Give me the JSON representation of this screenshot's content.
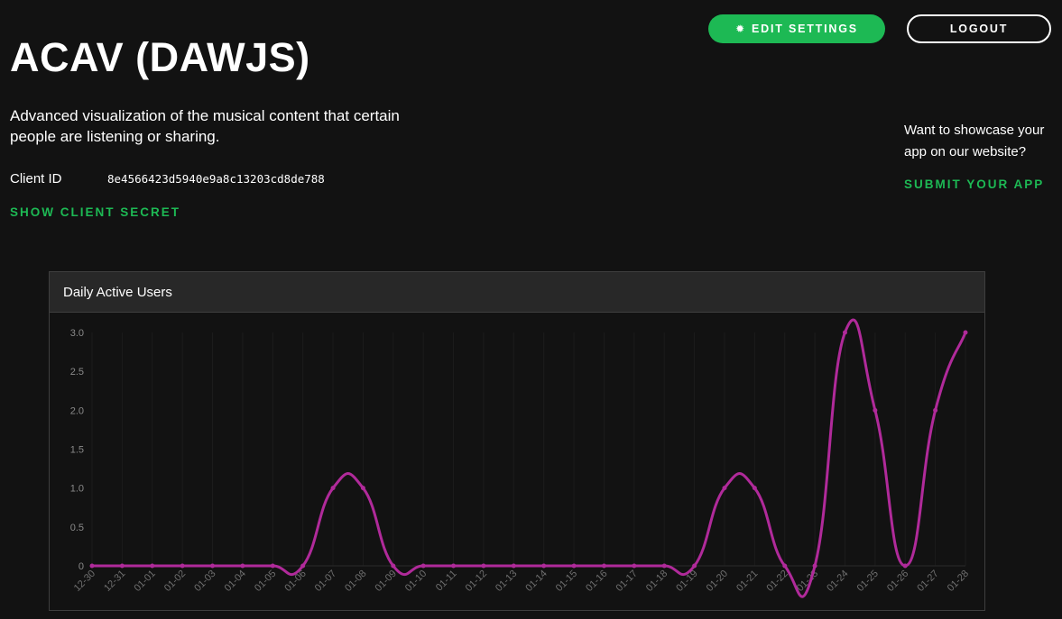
{
  "app": {
    "title": "ACAV (DAWJS)",
    "description": "Advanced visualization of the musical content that certain people are listening or sharing.",
    "client_id_label": "Client ID",
    "client_id": "8e4566423d5940e9a8c13203cd8de788",
    "show_secret_label": "SHOW CLIENT SECRET"
  },
  "toolbar": {
    "edit_settings_label": "EDIT SETTINGS",
    "edit_icon": "gear-icon",
    "logout_label": "LOGOUT"
  },
  "showcase": {
    "text": "Want to showcase your app on our website?",
    "submit_label": "SUBMIT YOUR APP"
  },
  "colors": {
    "background": "#121212",
    "accent": "#1db954",
    "line": "#b02a9a",
    "panel_header": "#282828"
  },
  "chart_data": {
    "type": "line",
    "title": "Daily Active Users",
    "categories": [
      "12-30",
      "12-31",
      "01-01",
      "01-02",
      "01-03",
      "01-04",
      "01-05",
      "01-06",
      "01-07",
      "01-08",
      "01-09",
      "01-10",
      "01-11",
      "01-12",
      "01-13",
      "01-14",
      "01-15",
      "01-16",
      "01-17",
      "01-18",
      "01-19",
      "01-20",
      "01-21",
      "01-22",
      "01-23",
      "01-24",
      "01-25",
      "01-26",
      "01-27",
      "01-28"
    ],
    "series": [
      {
        "values": [
          0,
          0,
          0,
          0,
          0,
          0,
          0,
          0,
          1,
          1,
          0,
          0,
          0,
          0,
          0,
          0,
          0,
          0,
          0,
          0,
          0,
          1,
          1,
          0,
          0,
          3,
          2,
          0,
          2,
          3
        ]
      }
    ],
    "yticks": [
      "0",
      "0.5",
      "1.0",
      "1.5",
      "2.0",
      "2.5",
      "3.0"
    ],
    "ylim": [
      0,
      3
    ],
    "xlabel": "",
    "ylabel": "",
    "grid": true
  }
}
